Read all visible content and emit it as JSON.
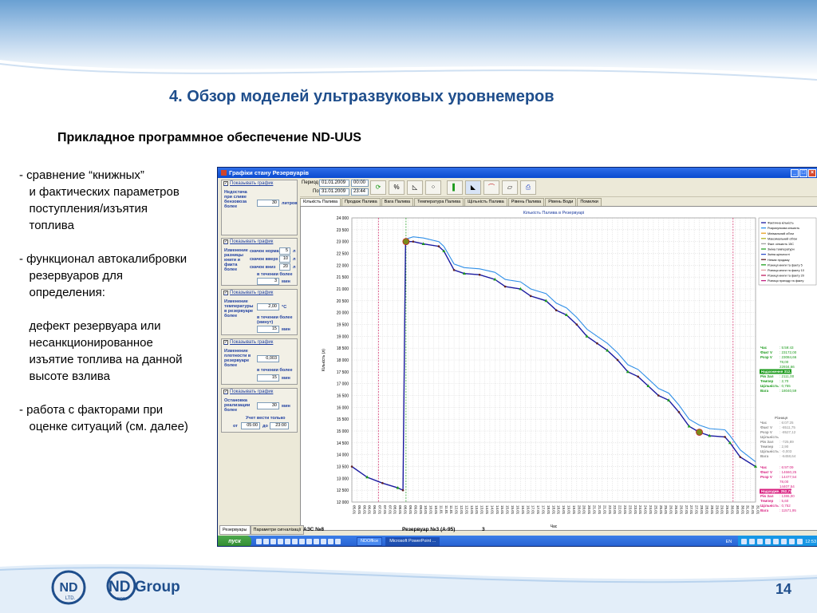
{
  "slide": {
    "title": "4.  Обзор моделей ультразвуковых уровнемеров",
    "subtitle": "Прикладное программное обеспечение ND-UUS",
    "bullets": [
      "- сравнение “книжных”",
      "   и фактических параметров",
      "   поступления/изъятия",
      "   топлива",
      "",
      "- функционал автокалибровки",
      "   резервуаров для",
      "   определения:",
      "",
      "   дефект резервуара или",
      "   несанкционированное",
      "   изъятие топлива на данной",
      "   высоте взлива",
      "",
      "- работа с факторами при",
      "   оценке ситуаций (см. далее)"
    ],
    "page_number": "14",
    "logo1_text": "ND",
    "logo1_sub": "LTD.",
    "logo2_text": "ND Group",
    "logo2_sub": "CORP."
  },
  "window": {
    "title": "Графіки стану Резервуарів",
    "btn_min": "_",
    "btn_max": "□",
    "btn_close": "×"
  },
  "left_panel": {
    "groups": [
      {
        "toggle": "Показывать график",
        "label": "Недостача\nпри сливе\nбензовоза\nболее",
        "value": "30",
        "unit": "литров"
      },
      {
        "toggle": "Показывать график",
        "label": "Изменение\nразницы\nкниги и\nфакта\nболее",
        "rows": [
          {
            "name": "скачок норма",
            "value": "5",
            "unit": "л"
          },
          {
            "name": "скачок вверх",
            "value": "10",
            "unit": "л"
          },
          {
            "name": "скачок вниз",
            "value": "20",
            "unit": "л"
          }
        ],
        "sub_label": "в течении более",
        "sub_value": "3",
        "sub_unit": "мин"
      },
      {
        "toggle": "Показывать график",
        "label": "Изменение\nтемпературы\nв резервуаре\nболее",
        "value": "2,00",
        "unit": "°C",
        "sub_label": "в течении более\n(минут)",
        "sub_value": "15",
        "sub_unit": "мин"
      },
      {
        "toggle": "Показывать график",
        "label": "Изменение\nплотности в\nрезервуаре\nболее",
        "value": "0,003",
        "sub_label": "в течении более",
        "sub_value": "15",
        "sub_unit": "мин"
      },
      {
        "toggle": "Показывать график",
        "label": "Остановка\nреализации\nболее",
        "value": "30",
        "unit": "мин",
        "sub_label": "Учет вести только",
        "from_label": "от",
        "from_value": "05:00",
        "to_label": "до",
        "to_value": "23:00"
      }
    ]
  },
  "toolbar": {
    "period_label": "Период  З:",
    "from_date": "01.01.2009",
    "from_time": "00:00",
    "to_label": "По:",
    "to_date": "31.01.2009",
    "to_time": "23:44"
  },
  "tabs": [
    "Кількість Палива",
    "Продаж Палива",
    "Вага Палива",
    "Температура Палива",
    "Щільність Палива",
    "Рівень Палива",
    "Рівень Води",
    "Помилки"
  ],
  "active_tab": 0,
  "bottom_tabs": [
    "Резервуары",
    "Параметри сигналізації"
  ],
  "status": {
    "station": "АЗС №8",
    "tank": "Резервуар №3 (А-95)",
    "count": "3"
  },
  "taskbar": {
    "start": "пуск",
    "tasks": [
      "NDOffice",
      "Microsoft PowerPoint ..."
    ],
    "lang": "EN",
    "clock": "12:53"
  },
  "colors": {
    "fact": "#1a1aa0",
    "calc": "#2f8fe8",
    "grid": "#bfbfbf",
    "marker_red": "#cc0000",
    "marker_green": "#1a9a1a",
    "title_blue": "#1f4e8c"
  },
  "chart_data": {
    "type": "line",
    "title": "Кількість Палива в Резервуарі",
    "ylabel": "Кількість (л)",
    "xlabel": "Час",
    "ylim": [
      12000,
      24000
    ],
    "yticks": [
      "12 000",
      "12 500",
      "13 000",
      "13 500",
      "14 000",
      "14 500",
      "15 000",
      "15 500",
      "16 000",
      "16 500",
      "17 000",
      "17 500",
      "18 000",
      "18 500",
      "19 000",
      "19 500",
      "20 000",
      "20 500",
      "21 000",
      "21 500",
      "22 000",
      "22 500",
      "23 000",
      "23 500",
      "24 000"
    ],
    "x_categories": [
      "05.01",
      "05.01",
      "06.01",
      "06.01",
      "06.01",
      "07.01",
      "07.01",
      "07.01",
      "08.01",
      "08.01",
      "08.01",
      "09.01",
      "09.01",
      "09.01",
      "10.01",
      "10.01",
      "10.01",
      "11.01",
      "11.01",
      "11.01",
      "12.01",
      "12.01",
      "12.01",
      "13.01",
      "13.01",
      "13.01",
      "14.01",
      "14.01",
      "14.01",
      "15.01",
      "15.01",
      "15.01",
      "16.01",
      "16.01",
      "16.01",
      "17.01",
      "17.01",
      "17.01",
      "18.01",
      "18.01",
      "18.01",
      "19.01",
      "19.01",
      "19.01",
      "20.01",
      "20.01",
      "20.01",
      "21.01",
      "21.01",
      "21.01",
      "22.01",
      "22.01",
      "22.01",
      "23.01",
      "23.01",
      "23.01",
      "24.01",
      "24.01",
      "24.01",
      "25.01",
      "25.01",
      "25.01",
      "26.01",
      "26.01",
      "26.01",
      "27.01",
      "27.01",
      "27.01",
      "28.01",
      "28.01",
      "28.01",
      "29.01",
      "29.01",
      "29.01",
      "30.01",
      "30.01",
      "30.01",
      "31.01",
      "31.01",
      "31.01"
    ],
    "series": [
      {
        "name": "Фактична кількість",
        "points": [
          [
            0,
            13500
          ],
          [
            3,
            13050
          ],
          [
            6,
            12800
          ],
          [
            9,
            12600
          ],
          [
            10,
            12500
          ],
          [
            10.5,
            23000
          ],
          [
            12,
            23000
          ],
          [
            14,
            22900
          ],
          [
            17,
            22800
          ],
          [
            18,
            22600
          ],
          [
            20,
            21800
          ],
          [
            22,
            21650
          ],
          [
            25,
            21600
          ],
          [
            28,
            21400
          ],
          [
            30,
            21100
          ],
          [
            33,
            21000
          ],
          [
            35,
            20700
          ],
          [
            38,
            20500
          ],
          [
            40,
            20100
          ],
          [
            42,
            19900
          ],
          [
            44,
            19500
          ],
          [
            46,
            19000
          ],
          [
            48,
            18700
          ],
          [
            50,
            18400
          ],
          [
            52,
            18000
          ],
          [
            54,
            17500
          ],
          [
            56,
            17300
          ],
          [
            58,
            16900
          ],
          [
            60,
            16500
          ],
          [
            62,
            16300
          ],
          [
            64,
            15800
          ],
          [
            66,
            15200
          ],
          [
            68,
            14950
          ],
          [
            70,
            14800
          ],
          [
            73,
            14750
          ],
          [
            74,
            14500
          ],
          [
            76,
            13900
          ],
          [
            79,
            13500
          ]
        ]
      },
      {
        "name": "Розрахункова кількість",
        "points": [
          [
            10.5,
            23100
          ],
          [
            12,
            23200
          ],
          [
            14,
            23150
          ],
          [
            17,
            23000
          ],
          [
            18,
            22800
          ],
          [
            20,
            22050
          ],
          [
            22,
            21900
          ],
          [
            25,
            21850
          ],
          [
            28,
            21700
          ],
          [
            30,
            21400
          ],
          [
            33,
            21300
          ],
          [
            35,
            21000
          ],
          [
            38,
            20800
          ],
          [
            40,
            20400
          ],
          [
            42,
            20200
          ],
          [
            44,
            19800
          ],
          [
            46,
            19300
          ],
          [
            48,
            19000
          ],
          [
            50,
            18700
          ],
          [
            52,
            18300
          ],
          [
            54,
            17800
          ],
          [
            56,
            17600
          ],
          [
            58,
            17200
          ],
          [
            60,
            16800
          ],
          [
            62,
            16600
          ],
          [
            64,
            16100
          ],
          [
            66,
            15500
          ],
          [
            68,
            15250
          ],
          [
            70,
            15100
          ],
          [
            73,
            15050
          ],
          [
            74,
            14800
          ],
          [
            76,
            14200
          ],
          [
            79,
            13700
          ]
        ]
      }
    ],
    "legend": [
      "Фактична кількість",
      "Розрахункова кількість",
      "Мінімальний об'єм",
      "Максимальний об'єм",
      "Факт. кількість 15С",
      "Зміна температури",
      "Зміна щільності",
      "Немає продажу",
      "Різниця книги та факту 5",
      "Різниця книги та факту 10",
      "Різниця книги та факту 20",
      "Різниця приходу та факту"
    ],
    "legend_colors": [
      "#1a1aa0",
      "#2f8fe8",
      "#e8a020",
      "#b0b020",
      "#a0a0a0",
      "#2aa02a",
      "#3050c8",
      "#602020",
      "#20a020",
      "#e0a0a0",
      "#c02060",
      "#c02080"
    ],
    "vlines": [
      5.2,
      10.6,
      74.6
    ],
    "side_panels": [
      {
        "color": "#1a9a1a",
        "rows": [
          [
            "Час",
            ": 5:59:43"
          ],
          [
            "Факт V",
            ": 23172,00"
          ],
          [
            "Розр V",
            ": 23084,66"
          ],
          [
            "",
            "",
            " 78,00"
          ],
          [
            "",
            "",
            " 22934,66"
          ]
        ],
        "badge": "Надхоження 312,79",
        "rows2": [
          [
            "Рів Зал",
            ": 2111,00"
          ],
          [
            "Темпер",
            ": 2,70"
          ],
          [
            "Щільність",
            ": 0,755"
          ],
          [
            "Вага",
            ": 18040,59"
          ]
        ]
      },
      {
        "color": "#888888",
        "header": "Різниця",
        "rows": [
          [
            "Час",
            ": 6:07:25"
          ],
          [
            "Факт V",
            ": -8511,75"
          ],
          [
            "Розр V",
            ": -8527,12"
          ],
          [
            "Щільність",
            ""
          ],
          [
            "Рів Зал",
            ": -725,89"
          ],
          [
            "Темпер",
            ": 2,90"
          ],
          [
            "Щільність",
            ": -0,003"
          ],
          [
            "Вага",
            ": -6458,64"
          ]
        ]
      },
      {
        "color": "#d82080",
        "rows": [
          [
            "Час",
            ": 6:97:09"
          ],
          [
            "Факт V",
            ": 14660,25"
          ],
          [
            "Розр V",
            ": 14477,54"
          ],
          [
            "",
            "",
            " 78,00"
          ],
          [
            "",
            "",
            " 14407,54"
          ]
        ],
        "badge": "Надходже. 252,71",
        "rows2": [
          [
            "Рів Зал",
            ": 1386,00"
          ],
          [
            "Темпер",
            ": 5,60"
          ],
          [
            "Щільність",
            ": 0,752"
          ],
          [
            "Вага",
            ": 11571,95"
          ]
        ]
      }
    ]
  }
}
